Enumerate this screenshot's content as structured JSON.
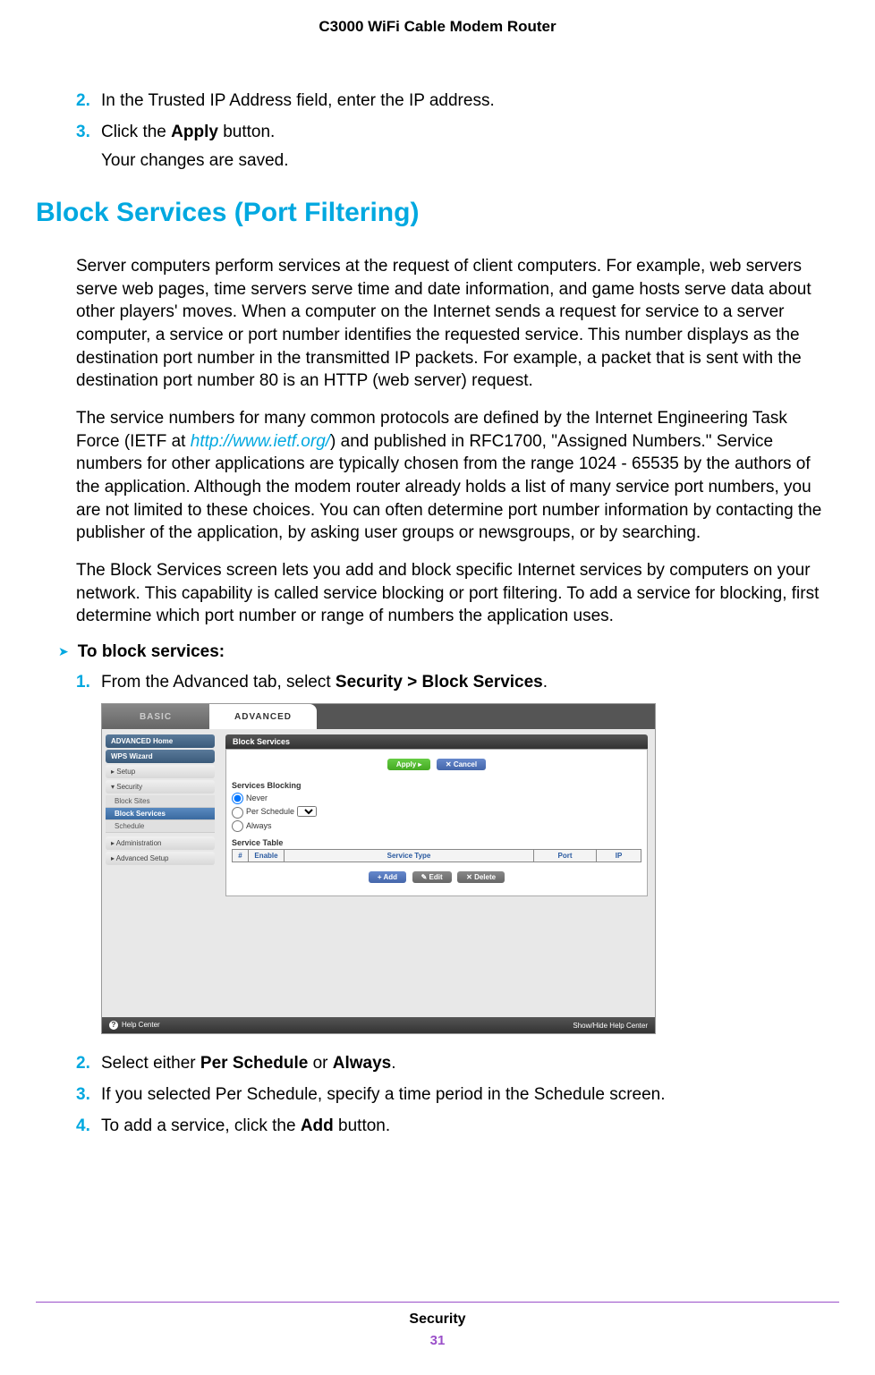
{
  "header": {
    "title": "C3000 WiFi Cable Modem Router"
  },
  "top_steps": [
    {
      "num": "2.",
      "text_before": "In the Trusted IP Address field, enter the IP address."
    },
    {
      "num": "3.",
      "text_before": "Click the ",
      "bold": "Apply",
      "text_after": " button."
    }
  ],
  "top_sub": "Your changes are saved.",
  "section_heading": "Block Services (Port Filtering)",
  "para1": "Server computers perform services at the request of client computers. For example, web servers serve web pages, time servers serve time and date information, and game hosts serve data about other players' moves. When a computer on the Internet sends a request for service to a server computer, a service or port number identifies the requested service. This number displays as the destination port number in the transmitted IP packets. For example, a packet that is sent with the destination port number 80 is an HTTP (web server) request.",
  "para2_a": "The service numbers for many common protocols are defined by the Internet Engineering Task Force (IETF at ",
  "para2_link": "http://www.ietf.org/",
  "para2_b": ") and published in RFC1700, \"Assigned Numbers.\" Service numbers for other applications are typically chosen from the range 1024 - 65535 by the authors of the application. Although the modem router already holds a list of many service port numbers, you are not limited to these choices. You can often determine port number information by contacting the publisher of the application, by asking user groups or newsgroups, or by searching.",
  "para3": "The Block Services screen lets you add and block specific Internet services by computers on your network. This capability is called service blocking or port filtering. To add a service for blocking, first determine which port number or range of numbers the application uses.",
  "proc_head": "To block services:",
  "steps": [
    {
      "num": "1.",
      "pre": "From the Advanced tab, select ",
      "bold": "Security > Block Services",
      "post": "."
    }
  ],
  "screenshot": {
    "tab_basic": "BASIC",
    "tab_advanced": "ADVANCED",
    "nav": {
      "home": "ADVANCED Home",
      "wps": "WPS Wizard",
      "setup": "▸ Setup",
      "security": "▾ Security",
      "sub": {
        "block_sites": "Block Sites",
        "block_services": "Block Services",
        "schedule": "Schedule"
      },
      "admin": "▸ Administration",
      "adv_setup": "▸ Advanced Setup"
    },
    "panel_title": "Block Services",
    "btns": {
      "apply": "Apply ▸",
      "cancel": "✕ Cancel",
      "add": "+ Add",
      "edit": "✎ Edit",
      "delete": "✕ Delete"
    },
    "services_blocking": "Services Blocking",
    "radios": {
      "never": "Never",
      "per_schedule": "Per Schedule",
      "always": "Always"
    },
    "service_table": "Service Table",
    "th": {
      "num": "#",
      "enable": "Enable",
      "type": "Service Type",
      "port": "Port",
      "ip": "IP"
    },
    "footer": {
      "help": "Help Center",
      "showhide": "Show/Hide Help Center"
    }
  },
  "steps2": [
    {
      "num": "2.",
      "pre": "Select either ",
      "bold1": "Per Schedule",
      "mid": " or ",
      "bold2": "Always",
      "post": "."
    },
    {
      "num": "3.",
      "pre": "If you selected Per Schedule, specify a time period in the Schedule screen."
    },
    {
      "num": "4.",
      "pre": "To add a service, click the ",
      "bold1": "Add",
      "post": " button."
    }
  ],
  "footer": {
    "label": "Security",
    "page": "31"
  }
}
